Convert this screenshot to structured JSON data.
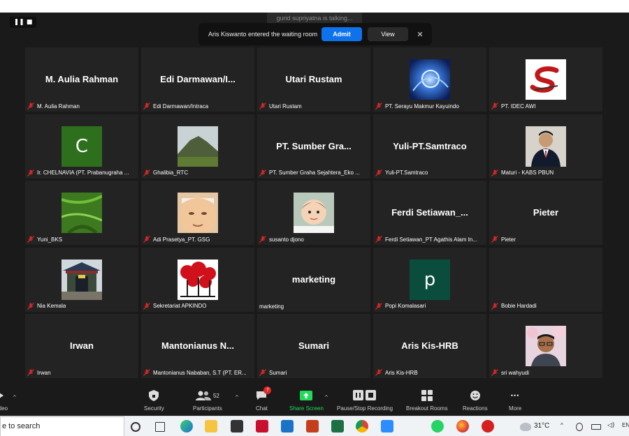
{
  "top": {
    "talking_indicator": "gurid supriyatna is talking..."
  },
  "waiting_room_notice": {
    "message": "Aris Kiswanto entered the waiting room",
    "admit_label": "Admit",
    "view_label": "View",
    "close_glyph": "✕"
  },
  "view_controls": {
    "pause_glyph": "❚❚",
    "stop_glyph": "■"
  },
  "participants": [
    {
      "display": "M. Aulia Rahman",
      "label": "M. Aulia Rahman",
      "avatar": "name"
    },
    {
      "display": "Edi  Darmawan/I...",
      "label": "Edi Darmawan/Intraca",
      "avatar": "name"
    },
    {
      "display": "Utari Rustam",
      "label": "Utari Rustam",
      "avatar": "name"
    },
    {
      "display": "",
      "label": "PT. Serayu Makmur Kayuindo",
      "avatar": "abstract-blue-photo"
    },
    {
      "display": "",
      "label": "PT. IDEC AWI",
      "avatar": "red-s-logo"
    },
    {
      "display": "",
      "letter": "C",
      "letter_color": "#2e6f1d",
      "label": "Ir. CHELNAVIA (PT. Prabanugraha ...",
      "avatar": "letter"
    },
    {
      "display": "",
      "label": "Ghalibia_RTC",
      "avatar": "mountain-photo"
    },
    {
      "display": "PT. Sumber Gra...",
      "label": "PT. Sumber Graha Sejahtera_Eko ...",
      "avatar": "name"
    },
    {
      "display": "Yuli-PT.Samtraco",
      "label": "Yuli-PT.Samtraco",
      "avatar": "name"
    },
    {
      "display": "",
      "label": "Maturi - KABS PBUN",
      "avatar": "man-portrait-photo"
    },
    {
      "display": "",
      "label": "Yuni_BKS",
      "avatar": "green-leaf-photo"
    },
    {
      "display": "",
      "label": "Adi Prasetya_PT. GSG",
      "avatar": "face-closeup-photo"
    },
    {
      "display": "",
      "label": "susanto djono",
      "avatar": "baby-photo"
    },
    {
      "display": "Ferdi  Setiawan_...",
      "label": "Ferdi Setiawan_PT Agathis Alam In...",
      "avatar": "name"
    },
    {
      "display": "Pieter",
      "label": "Pieter",
      "avatar": "name"
    },
    {
      "display": "",
      "label": "Nia Kemala",
      "avatar": "temple-photo"
    },
    {
      "display": "",
      "label": "Sekretariat APKINDO",
      "avatar": "red-trees-logo"
    },
    {
      "display": "marketing",
      "label": "marketing",
      "avatar": "name",
      "no_mic": true
    },
    {
      "display": "",
      "letter": "p",
      "letter_color": "#0b4d3c",
      "label": "Popi Komalasari",
      "avatar": "letter"
    },
    {
      "display": "",
      "label": "Bobie Hardadi",
      "avatar": "none"
    },
    {
      "display": "Irwan",
      "label": "Irwan",
      "avatar": "name"
    },
    {
      "display": "Mantonianus  N...",
      "label": "Mantonianus Nababan, S.T (PT. ER...",
      "avatar": "name"
    },
    {
      "display": "Sumari",
      "label": "Sumari",
      "avatar": "name"
    },
    {
      "display": "Aris Kis-HRB",
      "label": "Aris Kis-HRB",
      "avatar": "name"
    },
    {
      "display": "",
      "label": "sri wahyudi",
      "avatar": "man-glasses-photo"
    }
  ],
  "toolbar": {
    "video_label": "ideo",
    "security_label": "Security",
    "participants_label": "Participants",
    "participants_count": "52",
    "chat_label": "Chat",
    "chat_badge": "7",
    "share_label": "Share Screen",
    "recording_label": "Pause/Stop Recording",
    "breakout_label": "Breakout Rooms",
    "reactions_label": "Reactions",
    "more_label": "More",
    "caret": "^",
    "more_glyph": "•••"
  },
  "taskbar": {
    "search_text": "e to search",
    "temperature": "31°C",
    "lang": "EN",
    "icons": [
      "cortana-circle-icon",
      "task-view-icon",
      "edge-icon",
      "file-explorer-icon",
      "store-icon",
      "mcafee-icon",
      "mail-icon",
      "powerpoint-icon",
      "excel-icon",
      "chrome-icon",
      "zoom-icon",
      "whatsapp-icon",
      "firefox-icon",
      "app-red-icon"
    ]
  }
}
